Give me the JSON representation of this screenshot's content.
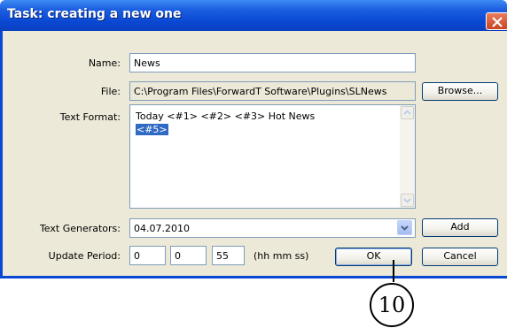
{
  "window": {
    "title": "Task: creating a new one"
  },
  "form": {
    "name_label": "Name:",
    "name_value": "News",
    "file_label": "File:",
    "file_value": "C:\\Program Files\\ForwardT Software\\Plugins\\SLNews",
    "browse_label": "Browse...",
    "text_format_label": "Text Format:",
    "text_format_line1": "Today <#1> <#2> <#3> Hot News",
    "text_format_line2": "<#5>",
    "text_generators_label": "Text Generators:",
    "text_generators_value": "04.07.2010",
    "add_label": "Add",
    "update_period_label": "Update Period:",
    "hh_value": "0",
    "mm_value": "0",
    "ss_value": "55",
    "units_label": "(hh mm ss)",
    "ok_label": "OK",
    "cancel_label": "Cancel"
  },
  "callout": {
    "number": "10"
  },
  "icons": {
    "close": "close-icon",
    "scroll_up": "scroll-up-icon",
    "scroll_down": "scroll-down-icon",
    "dropdown": "chevron-down-icon"
  }
}
